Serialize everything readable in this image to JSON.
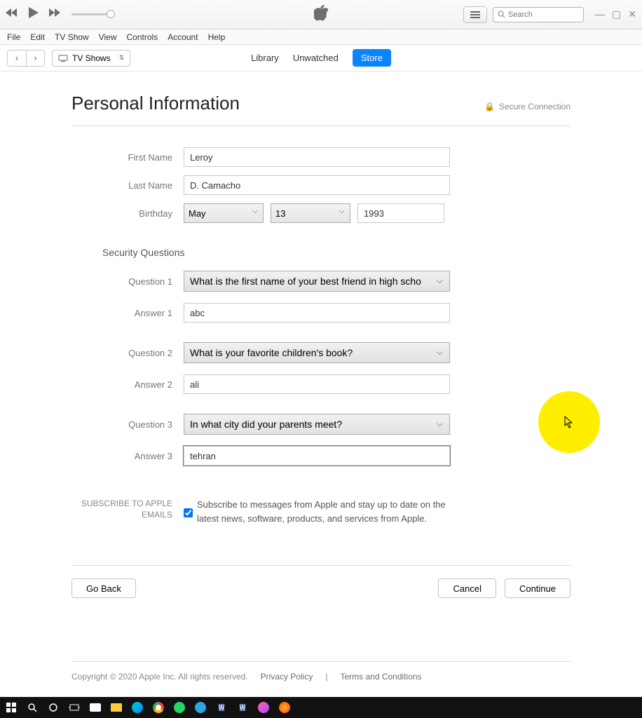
{
  "player": {
    "search_placeholder": "Search"
  },
  "menu": [
    "File",
    "Edit",
    "TV Show",
    "View",
    "Controls",
    "Account",
    "Help"
  ],
  "subnav": {
    "dropdown": "TV Shows",
    "tabs": [
      "Library",
      "Unwatched",
      "Store"
    ],
    "active_tab": 2
  },
  "page": {
    "title": "Personal Information",
    "secure": "Secure Connection"
  },
  "form": {
    "first_name_label": "First Name",
    "first_name": "Leroy",
    "last_name_label": "Last Name",
    "last_name": "D. Camacho",
    "birthday_label": "Birthday",
    "birthday_month": "May",
    "birthday_day": "13",
    "birthday_year": "1993"
  },
  "security": {
    "section_label": "Security Questions",
    "q1_label": "Question 1",
    "q1": "What is the first name of your best friend in high scho",
    "a1_label": "Answer 1",
    "a1": "abc",
    "q2_label": "Question 2",
    "q2": "What is your favorite children's book?",
    "a2_label": "Answer 2",
    "a2": "ali",
    "q3_label": "Question 3",
    "q3": "In what city did your parents meet?",
    "a3_label": "Answer 3",
    "a3": "tehran"
  },
  "subscribe": {
    "label": "SUBSCRIBE TO APPLE EMAILS",
    "checked": true,
    "text": "Subscribe to messages from Apple and stay up to date on the latest news, software, products, and services from Apple."
  },
  "buttons": {
    "back": "Go Back",
    "cancel": "Cancel",
    "continue": "Continue"
  },
  "footer": {
    "copyright": "Copyright © 2020 Apple Inc. All rights reserved.",
    "privacy": "Privacy Policy",
    "sep": "|",
    "terms": "Terms and Conditions"
  }
}
